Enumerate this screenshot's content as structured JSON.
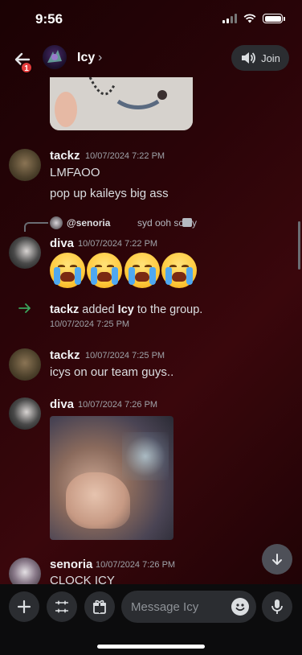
{
  "status_bar": {
    "time": "9:56"
  },
  "header": {
    "title": "Icy",
    "chevron": "›",
    "back_badge": "1",
    "join_label": "Join"
  },
  "messages": [
    {
      "author": "tackz",
      "timestamp": "10/07/2024 7:22 PM",
      "lines": [
        "LMFAOO",
        "pop up kaileys big ass"
      ]
    },
    {
      "reply": {
        "mention": "@senoria",
        "text": "syd ooh scary"
      },
      "author": "diva",
      "timestamp": "10/07/2024 7:22 PM",
      "emojis": [
        "loudly-crying-face",
        "loudly-crying-face",
        "loudly-crying-face",
        "loudly-crying-face"
      ]
    },
    {
      "author": "tackz",
      "timestamp": "10/07/2024 7:25 PM",
      "lines": [
        "icys on our team guys.."
      ]
    },
    {
      "author": "diva",
      "timestamp": "10/07/2024 7:26 PM"
    },
    {
      "author": "senoria",
      "timestamp": "10/07/2024 7:26 PM",
      "lines": [
        "CLOCK ICY"
      ]
    }
  ],
  "system_event": {
    "actor": "tackz",
    "action": " added ",
    "target": "Icy",
    "suffix": " to the group.",
    "timestamp": "10/07/2024 7:25 PM"
  },
  "composer": {
    "placeholder": "Message Icy"
  },
  "colors": {
    "accent_green": "#3ba55d",
    "badge_red": "#e23b3b",
    "input_bg": "#2b2d31"
  }
}
